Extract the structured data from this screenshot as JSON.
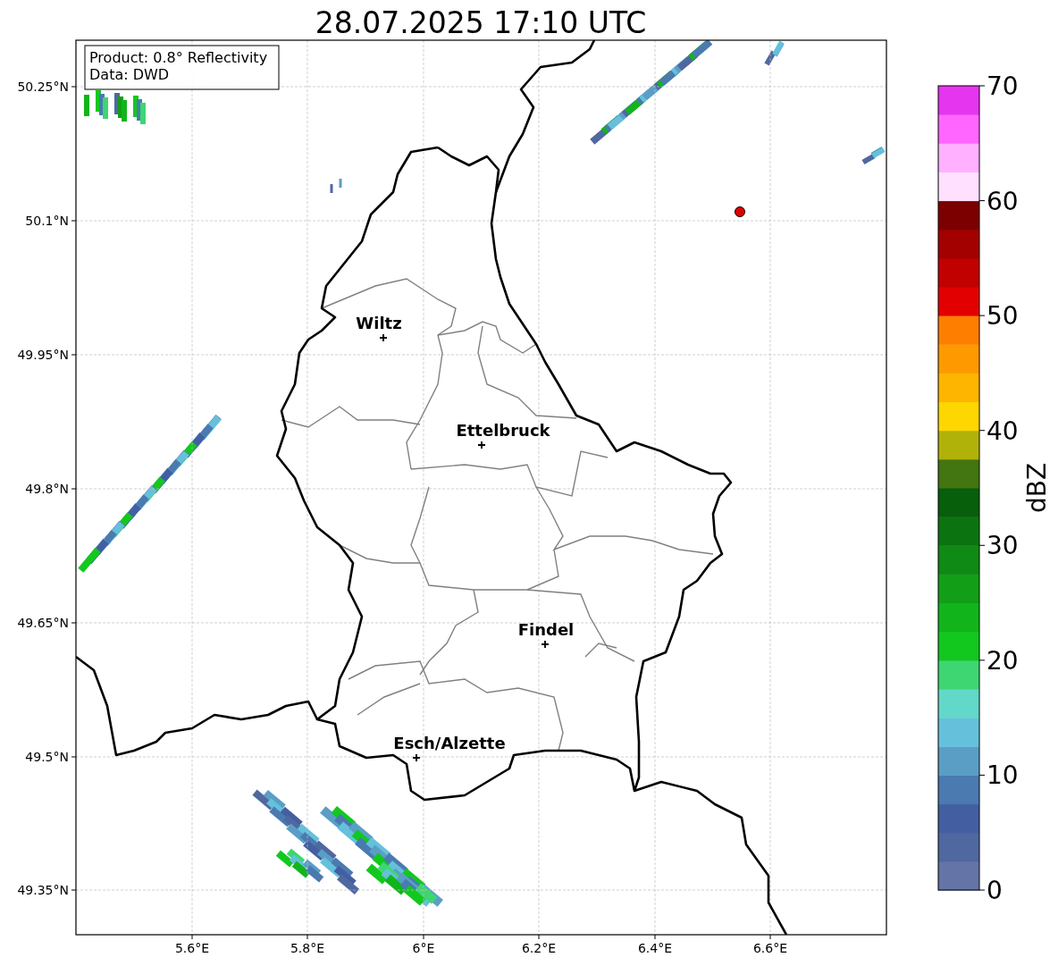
{
  "title": "28.07.2025 17:10 UTC",
  "legend": [
    "Product: 0.8° Reflectivity",
    "Data: DWD"
  ],
  "map": {
    "x_ticks": [
      "5.6°E",
      "5.8°E",
      "6°E",
      "6.2°E",
      "6.4°E",
      "6.6°E"
    ],
    "y_ticks": [
      "50.25°N",
      "50.1°N",
      "49.95°N",
      "49.8°N",
      "49.65°N",
      "49.5°N",
      "49.35°N"
    ],
    "cities": [
      {
        "name": "Wiltz"
      },
      {
        "name": "Ettelbruck"
      },
      {
        "name": "Findel"
      },
      {
        "name": "Esch/Alzette"
      }
    ]
  },
  "colorbar": {
    "label": "dBZ",
    "ticks": [
      "70",
      "60",
      "50",
      "40",
      "30",
      "20",
      "10",
      "0"
    ]
  }
}
